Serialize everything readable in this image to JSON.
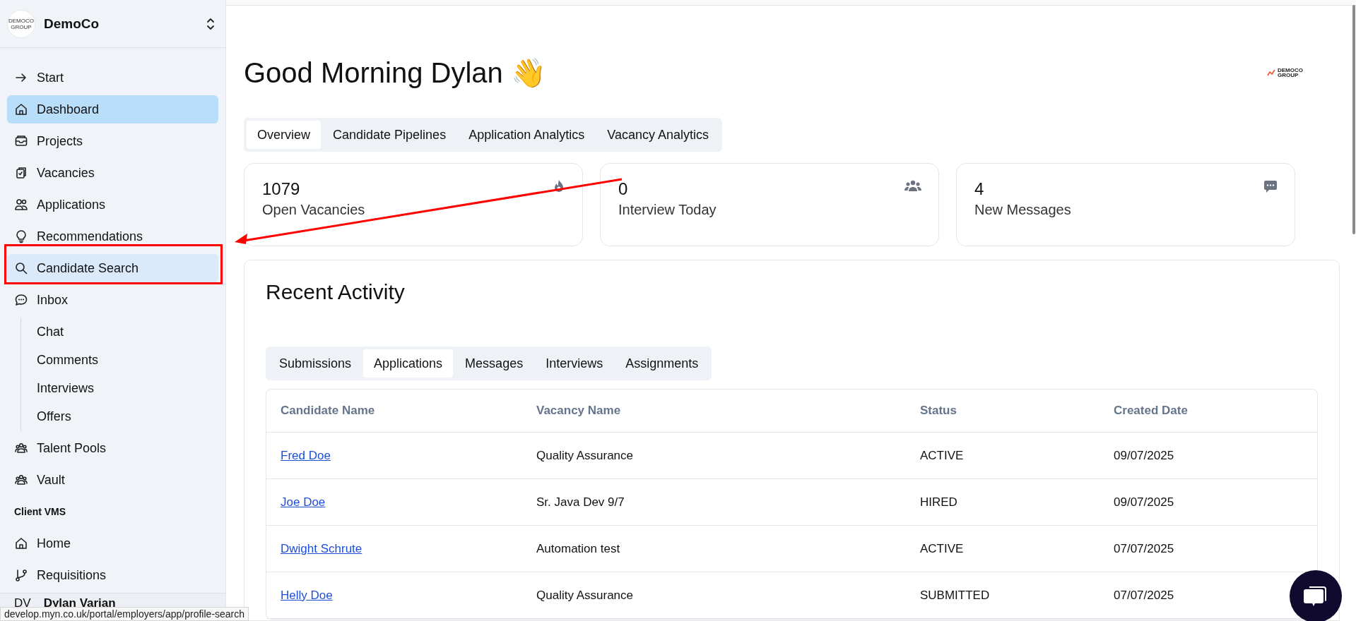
{
  "sidebar": {
    "org": {
      "name": "DemoCo",
      "logo_text": "DEMOCO GROUP"
    },
    "items": [
      {
        "kind": "link",
        "label": "Start",
        "selected": false,
        "hovered": false
      },
      {
        "kind": "link",
        "label": "Dashboard",
        "selected": true,
        "hovered": false
      },
      {
        "kind": "link",
        "label": "Projects",
        "selected": false,
        "hovered": false
      },
      {
        "kind": "link",
        "label": "Vacancies",
        "selected": false,
        "hovered": false
      },
      {
        "kind": "link",
        "label": "Applications",
        "selected": false,
        "hovered": false
      },
      {
        "kind": "link",
        "label": "Recommendations",
        "selected": false,
        "hovered": false
      },
      {
        "kind": "link",
        "label": "Candidate Search",
        "selected": false,
        "hovered": true
      },
      {
        "kind": "link",
        "label": "Inbox",
        "selected": false,
        "hovered": false,
        "children": [
          {
            "label": "Chat",
            "selected": false
          },
          {
            "label": "Comments",
            "selected": false
          },
          {
            "label": "Interviews",
            "selected": false
          },
          {
            "label": "Offers",
            "selected": false
          }
        ]
      },
      {
        "kind": "link",
        "label": "Talent Pools",
        "selected": false,
        "hovered": false
      },
      {
        "kind": "link",
        "label": "Vault",
        "selected": false,
        "hovered": false
      },
      {
        "kind": "heading",
        "label": "Client VMS"
      },
      {
        "kind": "link",
        "label": "Home",
        "selected": false,
        "hovered": false
      },
      {
        "kind": "link",
        "label": "Requisitions",
        "selected": false,
        "hovered": false
      }
    ],
    "user": {
      "initials": "DV",
      "name": "Dylan Varian"
    }
  },
  "greeting": "Good Morning Dylan 👋",
  "brand_logo": {
    "line_1": "DEMOCO",
    "line_2": "GROUP"
  },
  "tabs": [
    {
      "label": "Overview",
      "selected": true
    },
    {
      "label": "Candidate Pipelines",
      "selected": false
    },
    {
      "label": "Application Analytics",
      "selected": false
    },
    {
      "label": "Vacancy Analytics",
      "selected": false
    }
  ],
  "stats": [
    {
      "value": "1079",
      "label": "Open Vacancies"
    },
    {
      "value": "0",
      "label": "Interview Today"
    },
    {
      "value": "4",
      "label": "New Messages"
    }
  ],
  "recent_activity": {
    "title": "Recent Activity",
    "tabs": [
      {
        "label": "Submissions",
        "selected": false
      },
      {
        "label": "Applications",
        "selected": true
      },
      {
        "label": "Messages",
        "selected": false
      },
      {
        "label": "Interviews",
        "selected": false
      },
      {
        "label": "Assignments",
        "selected": false
      }
    ],
    "table": {
      "columns": [
        "Candidate Name",
        "Vacancy Name",
        "Status",
        "Created Date"
      ],
      "rows": [
        [
          "Fred Doe",
          "Quality Assurance",
          "ACTIVE",
          "09/07/2025"
        ],
        [
          "Joe Doe",
          "Sr. Java Dev 9/7",
          "HIRED",
          "09/07/2025"
        ],
        [
          "Dwight Schrute",
          "Automation test",
          "ACTIVE",
          "07/07/2025"
        ],
        [
          "Helly Doe",
          "Quality Assurance",
          "SUBMITTED",
          "07/07/2025"
        ]
      ]
    }
  },
  "annotations": {
    "highlight_frame": {
      "color": "#ff0000"
    },
    "arrow": {
      "color": "#ff0000"
    }
  },
  "status_bar": "develop.myn.co.uk/portal/employers/app/profile-search"
}
